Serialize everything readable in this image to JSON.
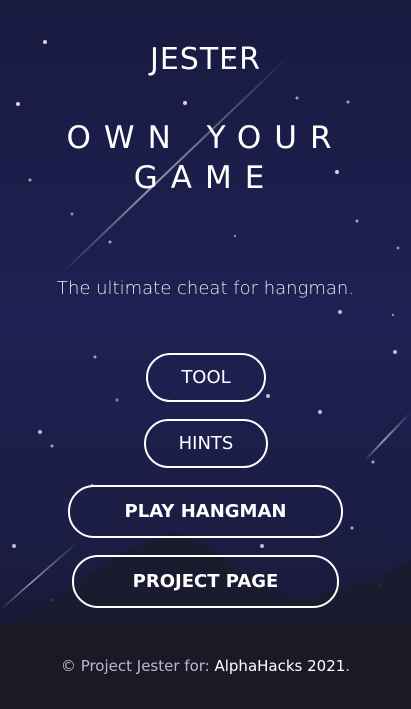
{
  "brand": "JESTER",
  "headline": {
    "line1": "OWN YOUR",
    "line2": "GAME"
  },
  "tagline": "The ultimate cheat for hangman.",
  "buttons": {
    "tool": "TOOL",
    "hints": "HINTS",
    "play": "PLAY HANGMAN",
    "project": "PROJECT PAGE"
  },
  "footer": {
    "prefix": "© Project Jester for: ",
    "link": "AlphaHacks 2021",
    "suffix": "."
  },
  "colors": {
    "background": "#1e2152",
    "mountain": "#1a1b2e",
    "text": "#ffffff"
  }
}
